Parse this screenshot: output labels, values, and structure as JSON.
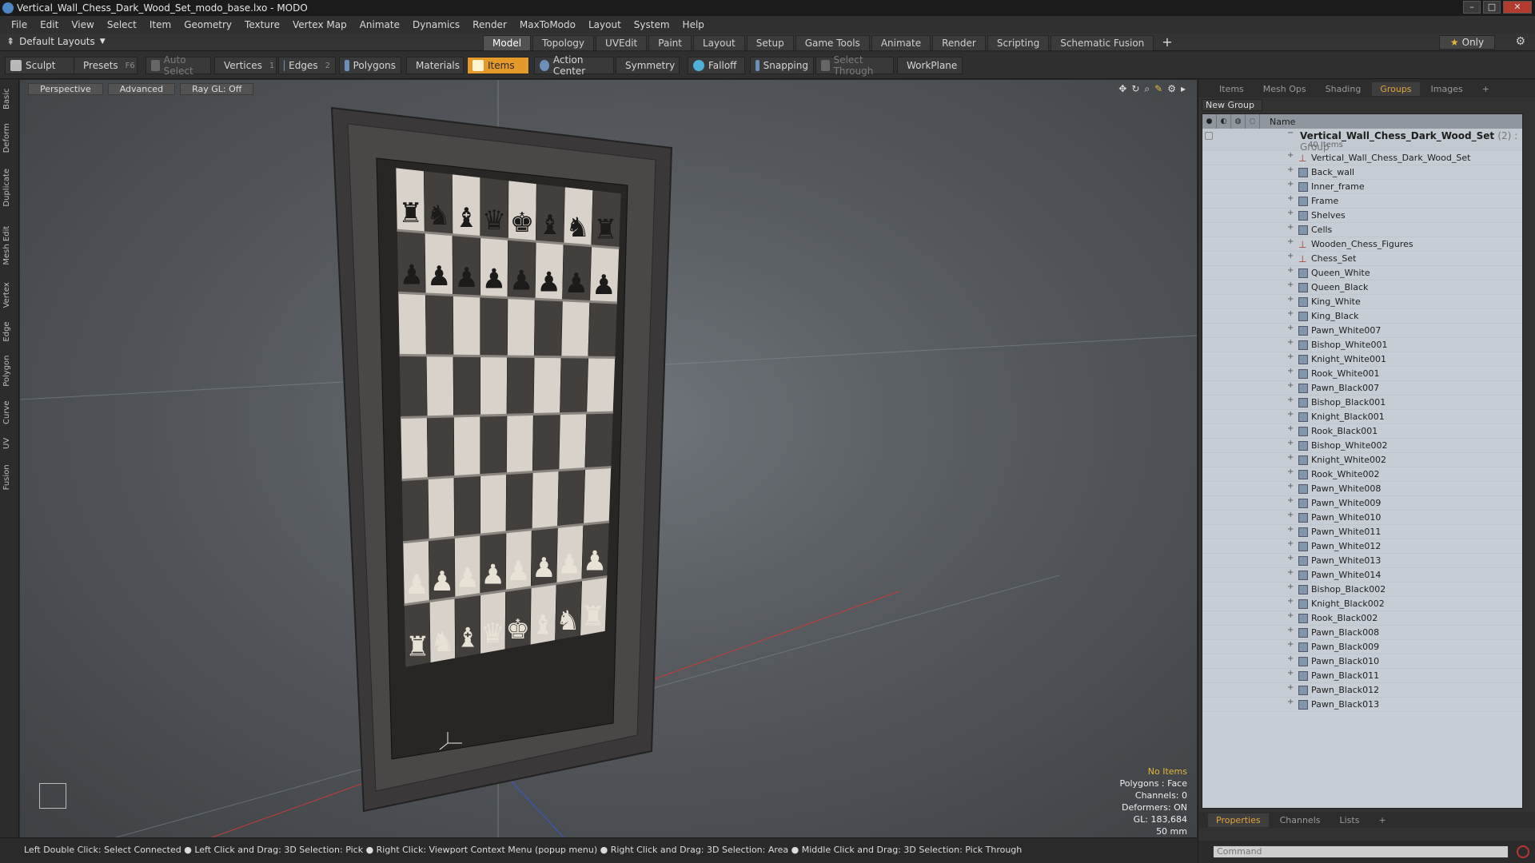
{
  "title": "Vertical_Wall_Chess_Dark_Wood_Set_modo_base.lxo - MODO",
  "menu": [
    "File",
    "Edit",
    "View",
    "Select",
    "Item",
    "Geometry",
    "Texture",
    "Vertex Map",
    "Animate",
    "Dynamics",
    "Render",
    "MaxToModo",
    "Layout",
    "System",
    "Help"
  ],
  "layout_select": "Default Layouts",
  "tabs": [
    "Model",
    "Topology",
    "UVEdit",
    "Paint",
    "Layout",
    "Setup",
    "Game Tools",
    "Animate",
    "Render",
    "Scripting",
    "Schematic Fusion"
  ],
  "active_tab": "Model",
  "only_label": "Only",
  "toolbar": {
    "sculpt": "Sculpt",
    "presets": "Presets",
    "presets_key": "F6",
    "auto_select": "Auto Select",
    "vertices": "Vertices",
    "vertices_key": "1",
    "edges": "Edges",
    "edges_key": "2",
    "polygons": "Polygons",
    "materials": "Materials",
    "items": "Items",
    "action_center": "Action Center",
    "symmetry": "Symmetry",
    "falloff": "Falloff",
    "snapping": "Snapping",
    "select_through": "Select Through",
    "workplane": "WorkPlane"
  },
  "left_tabs": [
    "Basic",
    "Deform",
    "Duplicate",
    "Mesh Edit",
    "Vertex",
    "Edge",
    "Polygon",
    "Curve",
    "UV",
    "Fusion"
  ],
  "viewport": {
    "perspective": "Perspective",
    "advanced": "Advanced",
    "raygl": "Ray GL: Off",
    "info": {
      "no_items": "No Items",
      "polygons": "Polygons : Face",
      "channels": "Channels: 0",
      "deformers": "Deformers: ON",
      "gl": "GL: 183,684",
      "scale": "50 mm"
    }
  },
  "status": "Left Double Click: Select Connected ● Left Click and Drag: 3D Selection: Pick ● Right Click: Viewport Context Menu (popup menu) ● Right Click and Drag: 3D Selection: Area ● Middle Click and Drag: 3D Selection: Pick Through",
  "right_tabs": [
    "Items",
    "Mesh Ops",
    "Shading",
    "Groups",
    "Images"
  ],
  "right_active_tab": "Groups",
  "new_group": "New Group",
  "list_header_name": "Name",
  "group": {
    "name": "Vertical_Wall_Chess_Dark_Wood_Set",
    "suffix": "(2) : Group",
    "count": "40 Items"
  },
  "items": [
    {
      "name": "Vertical_Wall_Chess_Dark_Wood_Set",
      "type": "locator"
    },
    {
      "name": "Back_wall",
      "type": "mesh"
    },
    {
      "name": "Inner_frame",
      "type": "mesh"
    },
    {
      "name": "Frame",
      "type": "mesh"
    },
    {
      "name": "Shelves",
      "type": "mesh"
    },
    {
      "name": "Cells",
      "type": "mesh"
    },
    {
      "name": "Wooden_Chess_Figures",
      "type": "locator"
    },
    {
      "name": "Chess_Set",
      "type": "locator"
    },
    {
      "name": "Queen_White",
      "type": "mesh"
    },
    {
      "name": "Queen_Black",
      "type": "mesh"
    },
    {
      "name": "King_White",
      "type": "mesh"
    },
    {
      "name": "King_Black",
      "type": "mesh"
    },
    {
      "name": "Pawn_White007",
      "type": "mesh"
    },
    {
      "name": "Bishop_White001",
      "type": "mesh"
    },
    {
      "name": "Knight_White001",
      "type": "mesh"
    },
    {
      "name": "Rook_White001",
      "type": "mesh"
    },
    {
      "name": "Pawn_Black007",
      "type": "mesh"
    },
    {
      "name": "Bishop_Black001",
      "type": "mesh"
    },
    {
      "name": "Knight_Black001",
      "type": "mesh"
    },
    {
      "name": "Rook_Black001",
      "type": "mesh"
    },
    {
      "name": "Bishop_White002",
      "type": "mesh"
    },
    {
      "name": "Knight_White002",
      "type": "mesh"
    },
    {
      "name": "Rook_White002",
      "type": "mesh"
    },
    {
      "name": "Pawn_White008",
      "type": "mesh"
    },
    {
      "name": "Pawn_White009",
      "type": "mesh"
    },
    {
      "name": "Pawn_White010",
      "type": "mesh"
    },
    {
      "name": "Pawn_White011",
      "type": "mesh"
    },
    {
      "name": "Pawn_White012",
      "type": "mesh"
    },
    {
      "name": "Pawn_White013",
      "type": "mesh"
    },
    {
      "name": "Pawn_White014",
      "type": "mesh"
    },
    {
      "name": "Bishop_Black002",
      "type": "mesh"
    },
    {
      "name": "Knight_Black002",
      "type": "mesh"
    },
    {
      "name": "Rook_Black002",
      "type": "mesh"
    },
    {
      "name": "Pawn_Black008",
      "type": "mesh"
    },
    {
      "name": "Pawn_Black009",
      "type": "mesh"
    },
    {
      "name": "Pawn_Black010",
      "type": "mesh"
    },
    {
      "name": "Pawn_Black011",
      "type": "mesh"
    },
    {
      "name": "Pawn_Black012",
      "type": "mesh"
    },
    {
      "name": "Pawn_Black013",
      "type": "mesh"
    }
  ],
  "bottom_tabs": [
    "Properties",
    "Channels",
    "Lists"
  ],
  "bottom_active_tab": "Properties",
  "command_placeholder": "Command",
  "colors": {
    "accent": "#e39a2b",
    "selected_tab": "#e2a43a",
    "list_bg": "#c7cdd5"
  }
}
